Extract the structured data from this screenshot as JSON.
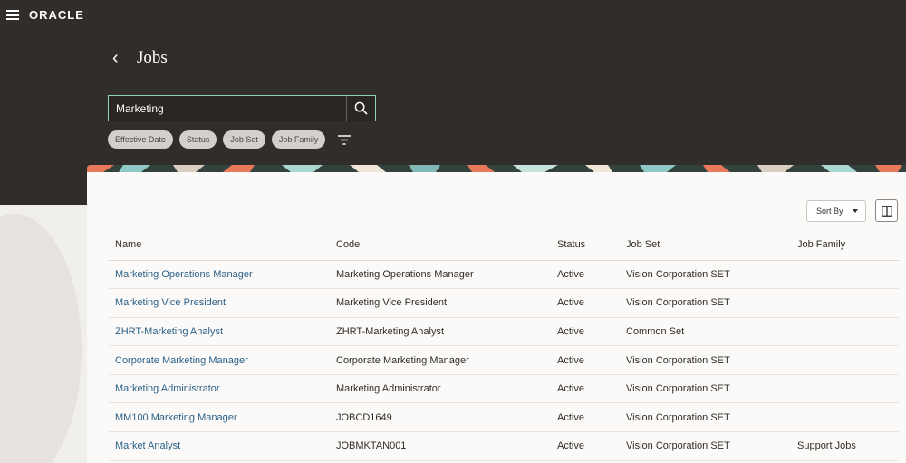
{
  "header": {
    "logo": "ORACLE"
  },
  "page": {
    "title": "Jobs",
    "back_glyph": "‹"
  },
  "search": {
    "value": "Marketing"
  },
  "chips": [
    "Effective Date",
    "Status",
    "Job Set",
    "Job Family"
  ],
  "toolbar": {
    "sort_label": "Sort By"
  },
  "table": {
    "columns": [
      "Name",
      "Code",
      "Status",
      "Job Set",
      "Job Family"
    ],
    "rows": [
      [
        "Marketing Operations Manager",
        "Marketing Operations Manager",
        "Active",
        "Vision Corporation SET",
        ""
      ],
      [
        "Marketing Vice President",
        "Marketing Vice President",
        "Active",
        "Vision Corporation SET",
        ""
      ],
      [
        "ZHRT-Marketing Analyst",
        "ZHRT-Marketing Analyst",
        "Active",
        "Common Set",
        ""
      ],
      [
        "Corporate Marketing Manager",
        "Corporate Marketing Manager",
        "Active",
        "Vision Corporation SET",
        ""
      ],
      [
        "Marketing Administrator",
        "Marketing Administrator",
        "Active",
        "Vision Corporation SET",
        ""
      ],
      [
        "MM100.Marketing Manager",
        "JOBCD1649",
        "Active",
        "Vision Corporation SET",
        ""
      ],
      [
        "Market Analyst",
        "JOBMKTAN001",
        "Active",
        "Vision Corporation SET",
        "Support Jobs"
      ]
    ]
  }
}
